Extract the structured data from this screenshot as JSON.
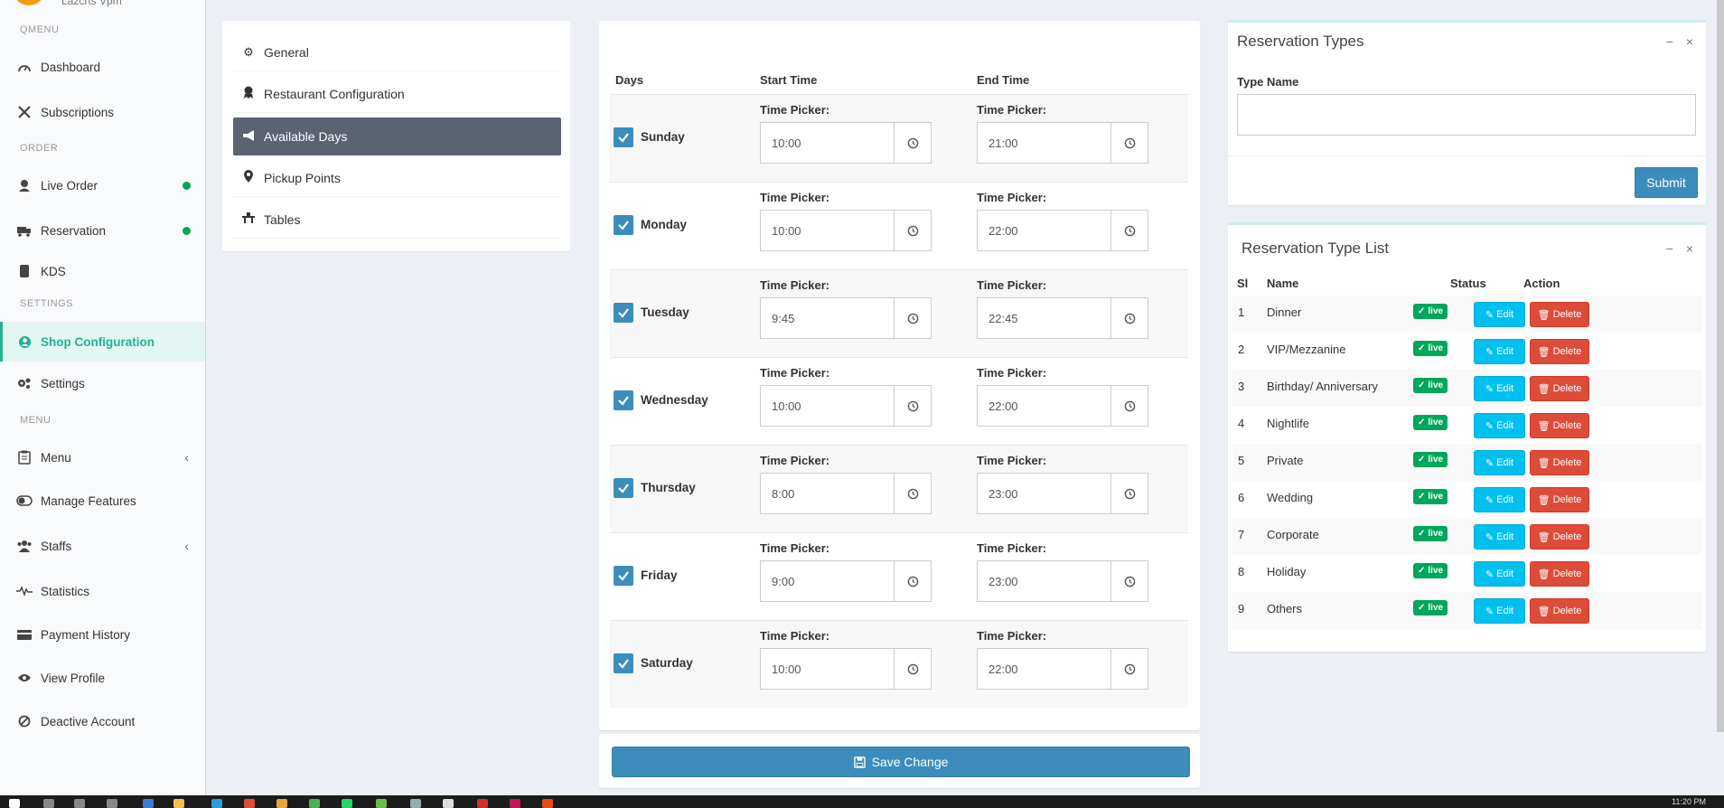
{
  "sidebar": {
    "user_text": "Lazcrts Vpm",
    "sections": {
      "qmenu": "QMENU",
      "order": "ORDER",
      "settings": "SETTINGS",
      "menu": "MENU"
    },
    "items": {
      "dashboard": "Dashboard",
      "subscriptions": "Subscriptions",
      "live_order": "Live Order",
      "reservation": "Reservation",
      "kds": "KDS",
      "shop_configuration": "Shop Configuration",
      "settings": "Settings",
      "menu": "Menu",
      "manage_features": "Manage Features",
      "staffs": "Staffs",
      "statistics": "Statistics",
      "payment_history": "Payment History",
      "view_profile": "View Profile",
      "deactive_account": "Deactive Account"
    },
    "active_color": "#21b193",
    "dot_color": "#00a65a"
  },
  "config_menu": {
    "general": "General",
    "restaurant_configuration": "Restaurant Configuration",
    "available_days": "Available Days",
    "pickup_points": "Pickup Points",
    "tables": "Tables"
  },
  "days_table": {
    "headers": {
      "days": "Days",
      "start_time": "Start Time",
      "end_time": "End Time"
    },
    "picker_label": "Time Picker:",
    "rows": [
      {
        "day": "Sunday",
        "start": "10:00",
        "end": "21:00",
        "checked": true
      },
      {
        "day": "Monday",
        "start": "10:00",
        "end": "22:00",
        "checked": true
      },
      {
        "day": "Tuesday",
        "start": "9:45",
        "end": "22:45",
        "checked": true
      },
      {
        "day": "Wednesday",
        "start": "10:00",
        "end": "22:00",
        "checked": true
      },
      {
        "day": "Thursday",
        "start": "8:00",
        "end": "23:00",
        "checked": true
      },
      {
        "day": "Friday",
        "start": "9:00",
        "end": "23:00",
        "checked": true
      },
      {
        "day": "Saturday",
        "start": "10:00",
        "end": "22:00",
        "checked": true
      }
    ],
    "save_label": "Save Change"
  },
  "reservation_types": {
    "title": "Reservation Types",
    "type_name_label": "Type Name",
    "type_name_value": "",
    "submit_label": "Submit"
  },
  "reservation_type_list": {
    "title": "Reservation Type List",
    "headers": {
      "sl": "Sl",
      "name": "Name",
      "status": "Status",
      "action": "Action"
    },
    "edit_label": "Edit",
    "delete_label": "Delete",
    "rows": [
      {
        "sl": "1",
        "name": "Dinner",
        "status": "live"
      },
      {
        "sl": "2",
        "name": "VIP/Mezzanine",
        "status": "live"
      },
      {
        "sl": "3",
        "name": "Birthday/ Anniversary",
        "status": "live"
      },
      {
        "sl": "4",
        "name": "Nightlife",
        "status": "live"
      },
      {
        "sl": "5",
        "name": "Private",
        "status": "live"
      },
      {
        "sl": "6",
        "name": "Wedding",
        "status": "live"
      },
      {
        "sl": "7",
        "name": "Corporate",
        "status": "live"
      },
      {
        "sl": "8",
        "name": "Holiday",
        "status": "live"
      },
      {
        "sl": "9",
        "name": "Others",
        "status": "live"
      }
    ]
  },
  "taskbar": {
    "time": "11:20 PM"
  },
  "colors": {
    "primary": "#3c8dbc",
    "info": "#00c0ef",
    "danger": "#dd4b39",
    "success": "#00a65a"
  }
}
